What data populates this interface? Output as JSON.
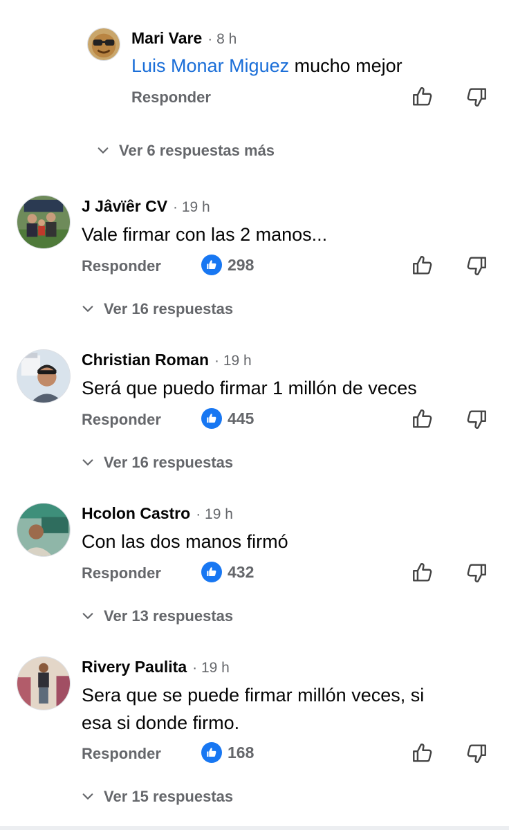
{
  "colors": {
    "accent": "#1877f2",
    "mention": "#1a6ed8",
    "secondary_text": "#65676b",
    "primary_text": "#050505"
  },
  "reply_comment": {
    "author": "Mari Vare",
    "time": "· 8 h",
    "mention": "Luis Monar Miguez",
    "text": " mucho mejor",
    "reply_label": "Responder"
  },
  "reply_thread_more": "Ver 6 respuestas más",
  "comments": [
    {
      "author": "J Jâvïêr CV",
      "time": "· 19 h",
      "text": "Vale firmar con las 2 manos...",
      "reply_label": "Responder",
      "likes": "298",
      "replies_label": "Ver 16 respuestas"
    },
    {
      "author": "Christian Roman",
      "time": "· 19 h",
      "text": "Será que puedo firmar 1 millón de veces",
      "reply_label": "Responder",
      "likes": "445",
      "replies_label": "Ver 16 respuestas"
    },
    {
      "author": "Hcolon Castro",
      "time": "· 19 h",
      "text": "Con las dos manos firmó",
      "reply_label": "Responder",
      "likes": "432",
      "replies_label": "Ver 13 respuestas"
    },
    {
      "author": "Rivery Paulita",
      "time": "· 19 h",
      "text_line1": "Sera que se puede firmar millón veces, si",
      "text_line2": "esa si donde firmo.",
      "reply_label": "Responder",
      "likes": "168",
      "replies_label": "Ver 15 respuestas"
    }
  ],
  "icons": {
    "like": "thumb-up-outline-icon",
    "dislike": "thumb-down-outline-icon",
    "like_reaction": "like-reaction-icon",
    "expand": "chevron-down-icon"
  }
}
